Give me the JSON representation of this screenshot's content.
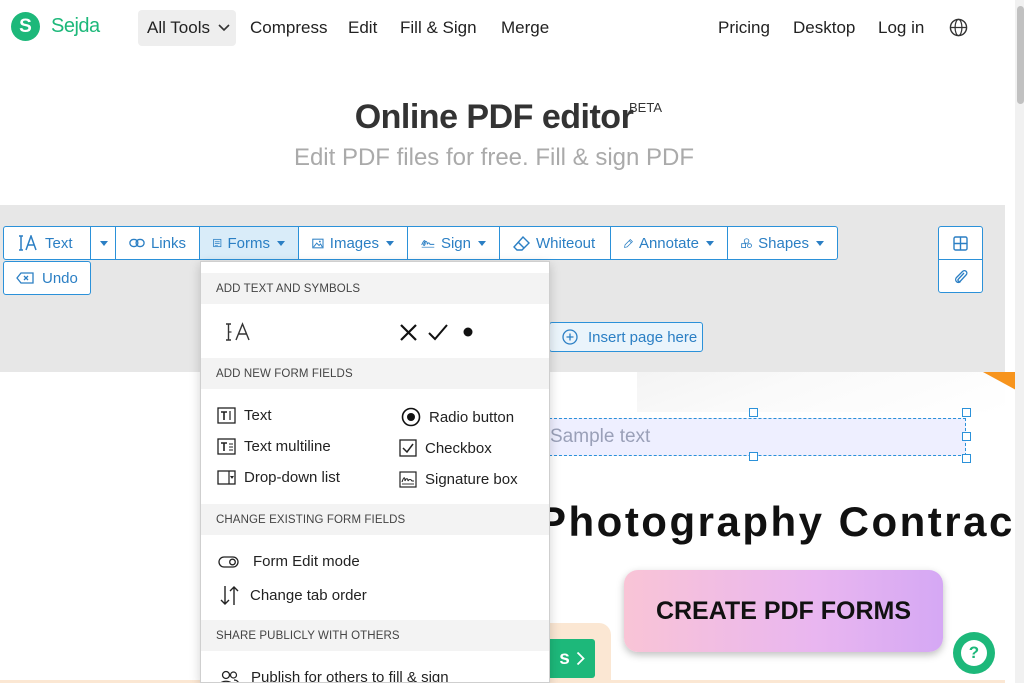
{
  "nav": {
    "brand": "Sejda",
    "brand_initial": "S",
    "all_tools": "All Tools",
    "links": [
      "Compress",
      "Edit",
      "Fill & Sign",
      "Merge"
    ],
    "right_links": [
      "Pricing",
      "Desktop",
      "Log in"
    ]
  },
  "hero": {
    "title": "Online PDF editor",
    "badge": "BETA",
    "subtitle": "Edit PDF files for free. Fill & sign PDF"
  },
  "toolbar": {
    "text": "Text",
    "links": "Links",
    "forms": "Forms",
    "images": "Images",
    "sign": "Sign",
    "whiteout": "Whiteout",
    "annotate": "Annotate",
    "shapes": "Shapes",
    "undo": "Undo",
    "insert_page": "Insert page here"
  },
  "forms_menu": {
    "section_symbols": "ADD TEXT AND SYMBOLS",
    "section_fields": "ADD NEW FORM FIELDS",
    "section_change": "CHANGE EXISTING FORM FIELDS",
    "section_share": "SHARE PUBLICLY WITH OTHERS",
    "field_text": "Text",
    "field_text_multiline": "Text multiline",
    "field_dropdown": "Drop-down list",
    "field_radio": "Radio button",
    "field_checkbox": "Checkbox",
    "field_signature": "Signature box",
    "edit_mode": "Form Edit mode",
    "tab_order": "Change tab order",
    "publish": "Publish for others to fill & sign"
  },
  "document": {
    "sample_text": "Sample text",
    "heading": "Photography Contrac",
    "cta": "CREATE PDF FORMS",
    "green_button_text": "s"
  },
  "help": {
    "label": "?"
  },
  "colors": {
    "brand_green": "#1db87a",
    "accent_blue": "#2b91d9",
    "annotation_orange": "#f7941d"
  }
}
